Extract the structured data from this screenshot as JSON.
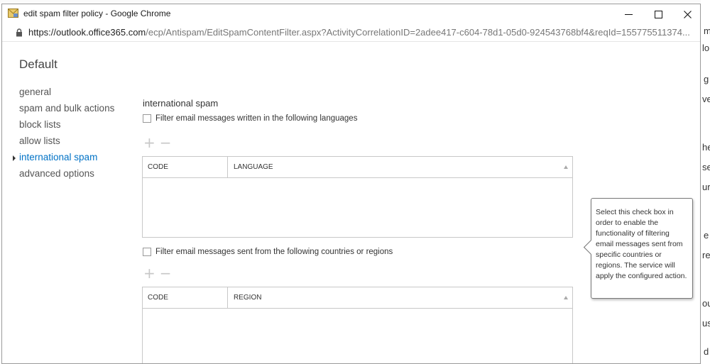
{
  "background": {
    "letters": [
      "m",
      "lo",
      "g",
      "ve",
      "he",
      "se",
      "ur",
      "e",
      "re",
      "ou",
      "us",
      "d"
    ]
  },
  "window": {
    "title": "edit spam filter policy - Google Chrome",
    "controls": {
      "minimize": "minimize-icon",
      "maximize": "maximize-icon",
      "close": "close-icon"
    }
  },
  "address": {
    "host": "https://outlook.office365.com",
    "path": "/ecp/Antispam/EditSpamContentFilter.aspx?ActivityCorrelationID=2adee417-c604-78d1-05d0-924543768bf4&reqId=155775511374..."
  },
  "page": {
    "title": "Default",
    "nav": [
      {
        "label": "general"
      },
      {
        "label": "spam and bulk actions"
      },
      {
        "label": "block lists"
      },
      {
        "label": "allow lists"
      },
      {
        "label": "international spam",
        "active": true
      },
      {
        "label": "advanced options"
      }
    ]
  },
  "section": {
    "title": "international spam",
    "languages": {
      "checkbox_label": "Filter email messages written in the following languages",
      "add": "+",
      "remove": "−",
      "columns": [
        "CODE",
        "LANGUAGE"
      ],
      "rows": []
    },
    "regions": {
      "checkbox_label": "Filter email messages sent from the following countries or regions",
      "add": "+",
      "remove": "−",
      "columns": [
        "CODE",
        "REGION"
      ],
      "rows": []
    }
  },
  "tooltip": {
    "text": "Select this check box in order to enable the functionality of filtering email messages sent from specific countries or regions. The service will apply the configured action."
  },
  "colors": {
    "accent": "#0072c6",
    "border": "#c8c8c8"
  }
}
